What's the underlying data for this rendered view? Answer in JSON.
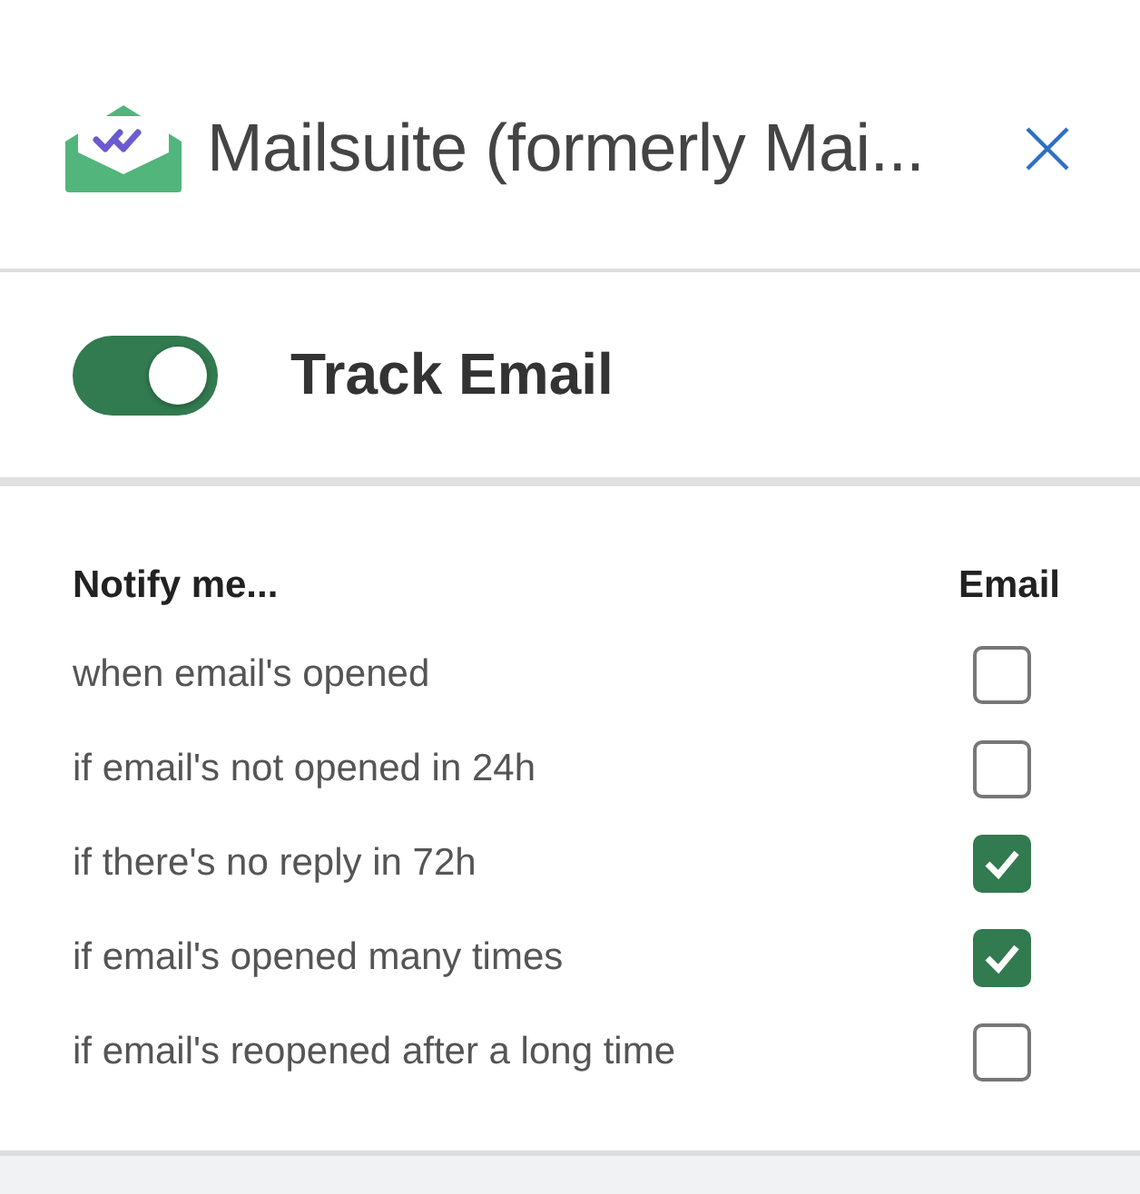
{
  "header": {
    "title": "Mailsuite (formerly Mai..."
  },
  "tracking": {
    "label": "Track Email",
    "on": true
  },
  "table": {
    "columns": [
      "Notify me...",
      "Email"
    ],
    "rows": [
      {
        "label": "when email's opened",
        "checked": false
      },
      {
        "label": "if email's not opened in 24h",
        "checked": false
      },
      {
        "label": "if there's no reply in 72h",
        "checked": true
      },
      {
        "label": "if email's opened many times",
        "checked": true
      },
      {
        "label": "if email's reopened after a long time",
        "checked": false
      }
    ]
  }
}
